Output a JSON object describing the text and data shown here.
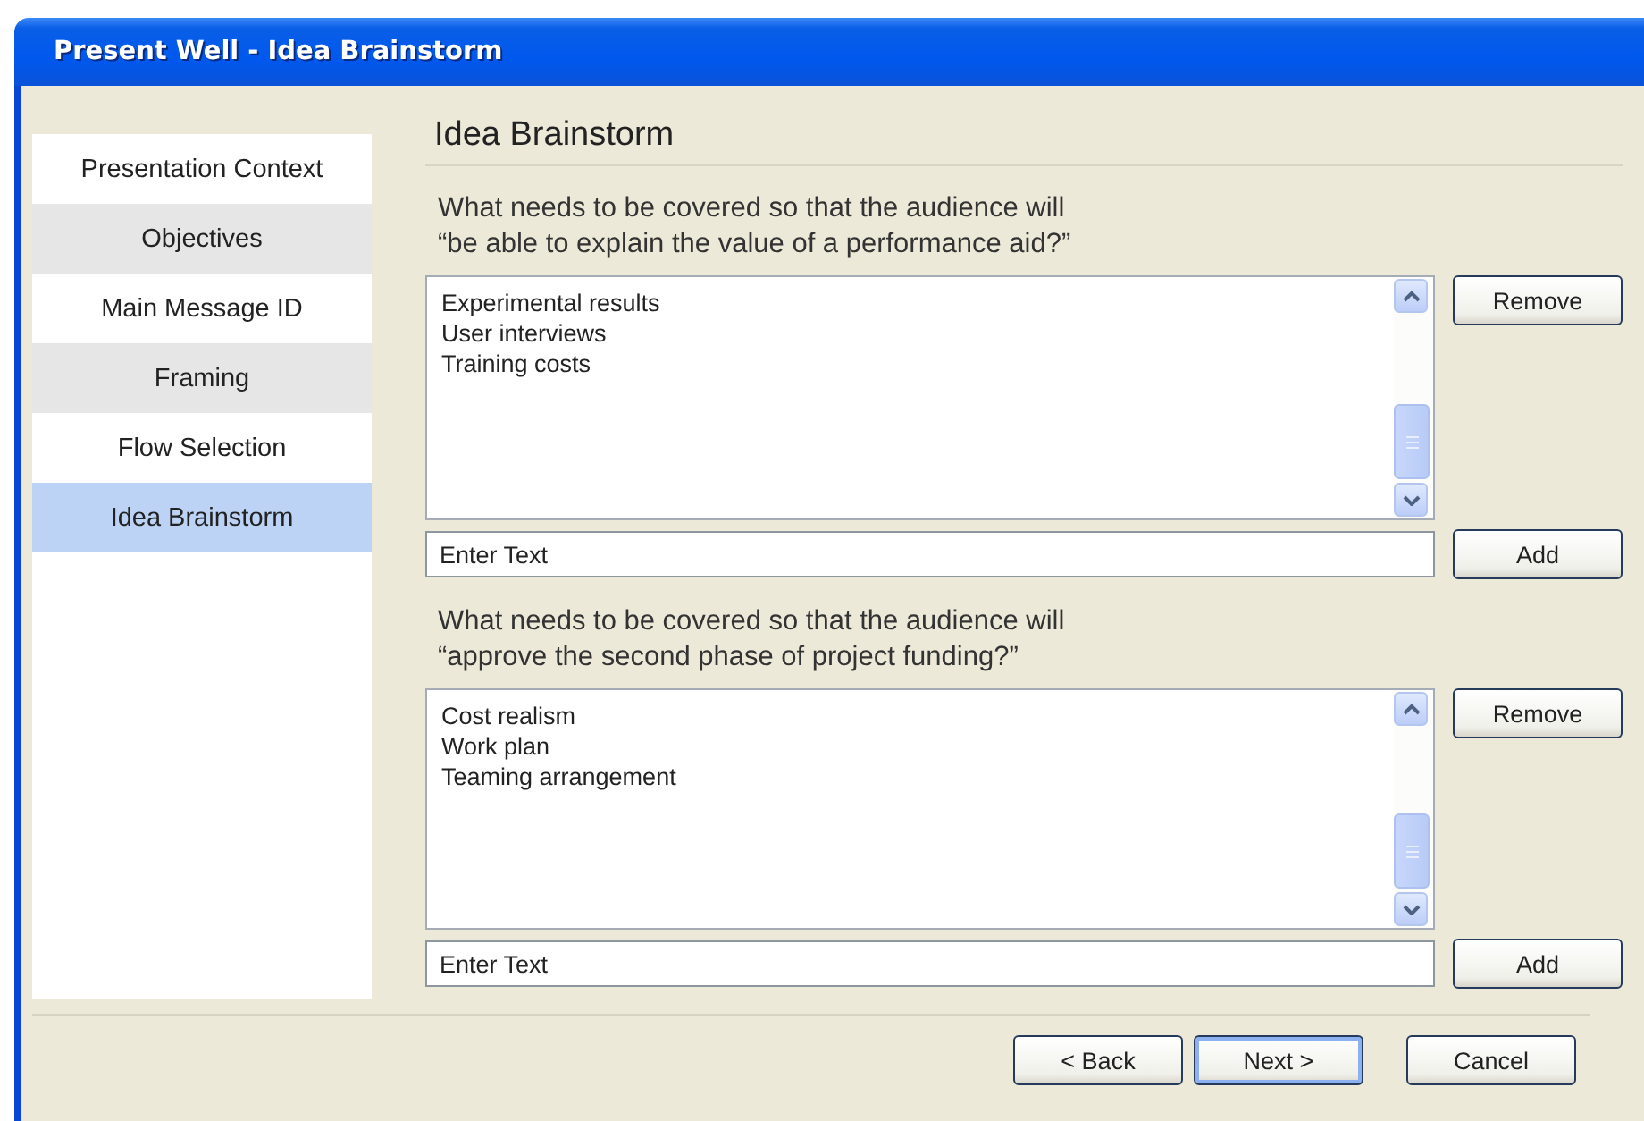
{
  "window": {
    "title": "Present Well - Idea Brainstorm"
  },
  "sidebar": {
    "items": [
      {
        "label": "Presentation Context",
        "selected": false
      },
      {
        "label": "Objectives",
        "selected": false
      },
      {
        "label": "Main Message ID",
        "selected": false
      },
      {
        "label": "Framing",
        "selected": false
      },
      {
        "label": "Flow Selection",
        "selected": false
      },
      {
        "label": "Idea Brainstorm",
        "selected": true
      }
    ]
  },
  "heading": "Idea Brainstorm",
  "sections": [
    {
      "question": "What needs to be covered so that the audience will\n“be able to explain the value of a performance aid?”",
      "items": [
        "Experimental results",
        "User interviews",
        "Training costs"
      ],
      "remove_button": "Remove",
      "entry": {
        "placeholder": "Enter Text"
      },
      "add_button": "Add"
    },
    {
      "question": "What needs to be covered so that the audience will\n“approve the second phase of project funding?”",
      "items": [
        "Cost realism",
        "Work plan",
        "Teaming arrangement"
      ],
      "remove_button": "Remove",
      "entry": {
        "placeholder": "Enter Text"
      },
      "add_button": "Add"
    }
  ],
  "footer_buttons": [
    {
      "label": "< Back",
      "default": false
    },
    {
      "label": "Next >",
      "default": true
    },
    {
      "label": "Cancel",
      "default": false
    }
  ]
}
